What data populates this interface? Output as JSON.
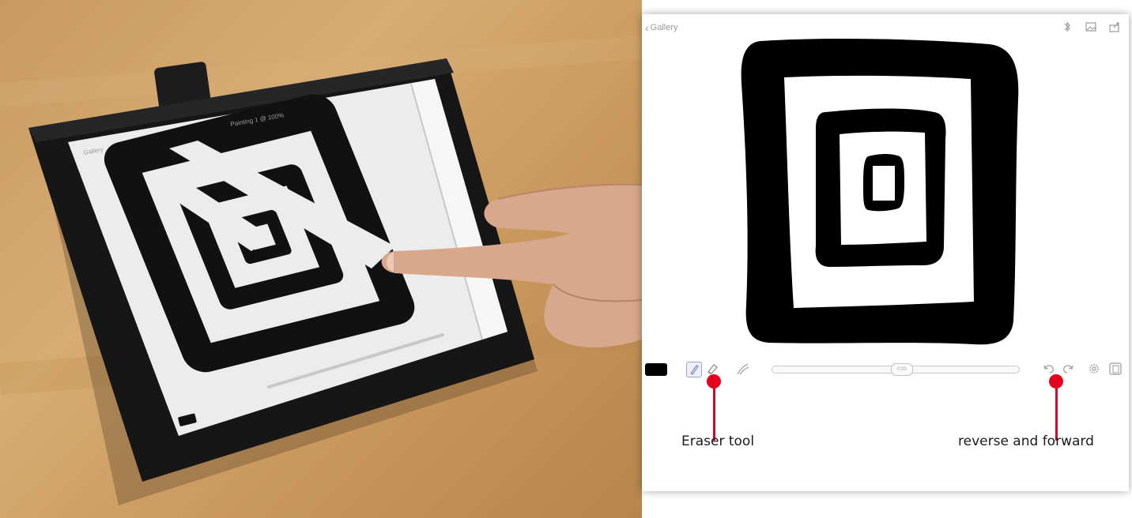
{
  "photo": {
    "tablet_title": "Painting 1 @ 100%",
    "tablet_back_label": "Gallery",
    "colors": {
      "table": "#cf9f66",
      "tablet": "#141414",
      "screen": "#e9e9e9",
      "skin": "#d9a98f"
    }
  },
  "app": {
    "back_label": "Gallery",
    "top_icons": [
      "bluetooth-icon",
      "image-icon",
      "share-icon"
    ],
    "toolbar": {
      "color_swatch": "#000000",
      "tools": [
        "brush-icon",
        "eraser-icon",
        "smudge-icon"
      ],
      "timeline_label": "0:00",
      "right_icons": [
        "undo-icon",
        "redo-icon",
        "settings-icon",
        "layers-icon"
      ]
    }
  },
  "annotations": {
    "eraser": "Eraser tool",
    "reverse_forward": "reverse and forward",
    "marker_color": "#e5001f"
  }
}
